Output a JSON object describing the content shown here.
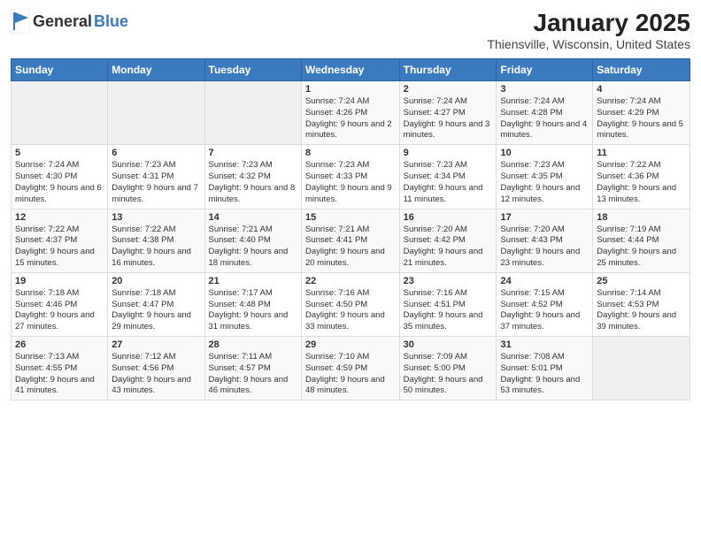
{
  "header": {
    "logo_general": "General",
    "logo_blue": "Blue",
    "title": "January 2025",
    "subtitle": "Thiensville, Wisconsin, United States"
  },
  "weekdays": [
    "Sunday",
    "Monday",
    "Tuesday",
    "Wednesday",
    "Thursday",
    "Friday",
    "Saturday"
  ],
  "weeks": [
    [
      {
        "day": "",
        "info": ""
      },
      {
        "day": "",
        "info": ""
      },
      {
        "day": "",
        "info": ""
      },
      {
        "day": "1",
        "info": "Sunrise: 7:24 AM\nSunset: 4:26 PM\nDaylight: 9 hours and 2 minutes."
      },
      {
        "day": "2",
        "info": "Sunrise: 7:24 AM\nSunset: 4:27 PM\nDaylight: 9 hours and 3 minutes."
      },
      {
        "day": "3",
        "info": "Sunrise: 7:24 AM\nSunset: 4:28 PM\nDaylight: 9 hours and 4 minutes."
      },
      {
        "day": "4",
        "info": "Sunrise: 7:24 AM\nSunset: 4:29 PM\nDaylight: 9 hours and 5 minutes."
      }
    ],
    [
      {
        "day": "5",
        "info": "Sunrise: 7:24 AM\nSunset: 4:30 PM\nDaylight: 9 hours and 6 minutes."
      },
      {
        "day": "6",
        "info": "Sunrise: 7:23 AM\nSunset: 4:31 PM\nDaylight: 9 hours and 7 minutes."
      },
      {
        "day": "7",
        "info": "Sunrise: 7:23 AM\nSunset: 4:32 PM\nDaylight: 9 hours and 8 minutes."
      },
      {
        "day": "8",
        "info": "Sunrise: 7:23 AM\nSunset: 4:33 PM\nDaylight: 9 hours and 9 minutes."
      },
      {
        "day": "9",
        "info": "Sunrise: 7:23 AM\nSunset: 4:34 PM\nDaylight: 9 hours and 11 minutes."
      },
      {
        "day": "10",
        "info": "Sunrise: 7:23 AM\nSunset: 4:35 PM\nDaylight: 9 hours and 12 minutes."
      },
      {
        "day": "11",
        "info": "Sunrise: 7:22 AM\nSunset: 4:36 PM\nDaylight: 9 hours and 13 minutes."
      }
    ],
    [
      {
        "day": "12",
        "info": "Sunrise: 7:22 AM\nSunset: 4:37 PM\nDaylight: 9 hours and 15 minutes."
      },
      {
        "day": "13",
        "info": "Sunrise: 7:22 AM\nSunset: 4:38 PM\nDaylight: 9 hours and 16 minutes."
      },
      {
        "day": "14",
        "info": "Sunrise: 7:21 AM\nSunset: 4:40 PM\nDaylight: 9 hours and 18 minutes."
      },
      {
        "day": "15",
        "info": "Sunrise: 7:21 AM\nSunset: 4:41 PM\nDaylight: 9 hours and 20 minutes."
      },
      {
        "day": "16",
        "info": "Sunrise: 7:20 AM\nSunset: 4:42 PM\nDaylight: 9 hours and 21 minutes."
      },
      {
        "day": "17",
        "info": "Sunrise: 7:20 AM\nSunset: 4:43 PM\nDaylight: 9 hours and 23 minutes."
      },
      {
        "day": "18",
        "info": "Sunrise: 7:19 AM\nSunset: 4:44 PM\nDaylight: 9 hours and 25 minutes."
      }
    ],
    [
      {
        "day": "19",
        "info": "Sunrise: 7:18 AM\nSunset: 4:46 PM\nDaylight: 9 hours and 27 minutes."
      },
      {
        "day": "20",
        "info": "Sunrise: 7:18 AM\nSunset: 4:47 PM\nDaylight: 9 hours and 29 minutes."
      },
      {
        "day": "21",
        "info": "Sunrise: 7:17 AM\nSunset: 4:48 PM\nDaylight: 9 hours and 31 minutes."
      },
      {
        "day": "22",
        "info": "Sunrise: 7:16 AM\nSunset: 4:50 PM\nDaylight: 9 hours and 33 minutes."
      },
      {
        "day": "23",
        "info": "Sunrise: 7:16 AM\nSunset: 4:51 PM\nDaylight: 9 hours and 35 minutes."
      },
      {
        "day": "24",
        "info": "Sunrise: 7:15 AM\nSunset: 4:52 PM\nDaylight: 9 hours and 37 minutes."
      },
      {
        "day": "25",
        "info": "Sunrise: 7:14 AM\nSunset: 4:53 PM\nDaylight: 9 hours and 39 minutes."
      }
    ],
    [
      {
        "day": "26",
        "info": "Sunrise: 7:13 AM\nSunset: 4:55 PM\nDaylight: 9 hours and 41 minutes."
      },
      {
        "day": "27",
        "info": "Sunrise: 7:12 AM\nSunset: 4:56 PM\nDaylight: 9 hours and 43 minutes."
      },
      {
        "day": "28",
        "info": "Sunrise: 7:11 AM\nSunset: 4:57 PM\nDaylight: 9 hours and 46 minutes."
      },
      {
        "day": "29",
        "info": "Sunrise: 7:10 AM\nSunset: 4:59 PM\nDaylight: 9 hours and 48 minutes."
      },
      {
        "day": "30",
        "info": "Sunrise: 7:09 AM\nSunset: 5:00 PM\nDaylight: 9 hours and 50 minutes."
      },
      {
        "day": "31",
        "info": "Sunrise: 7:08 AM\nSunset: 5:01 PM\nDaylight: 9 hours and 53 minutes."
      },
      {
        "day": "",
        "info": ""
      }
    ]
  ]
}
